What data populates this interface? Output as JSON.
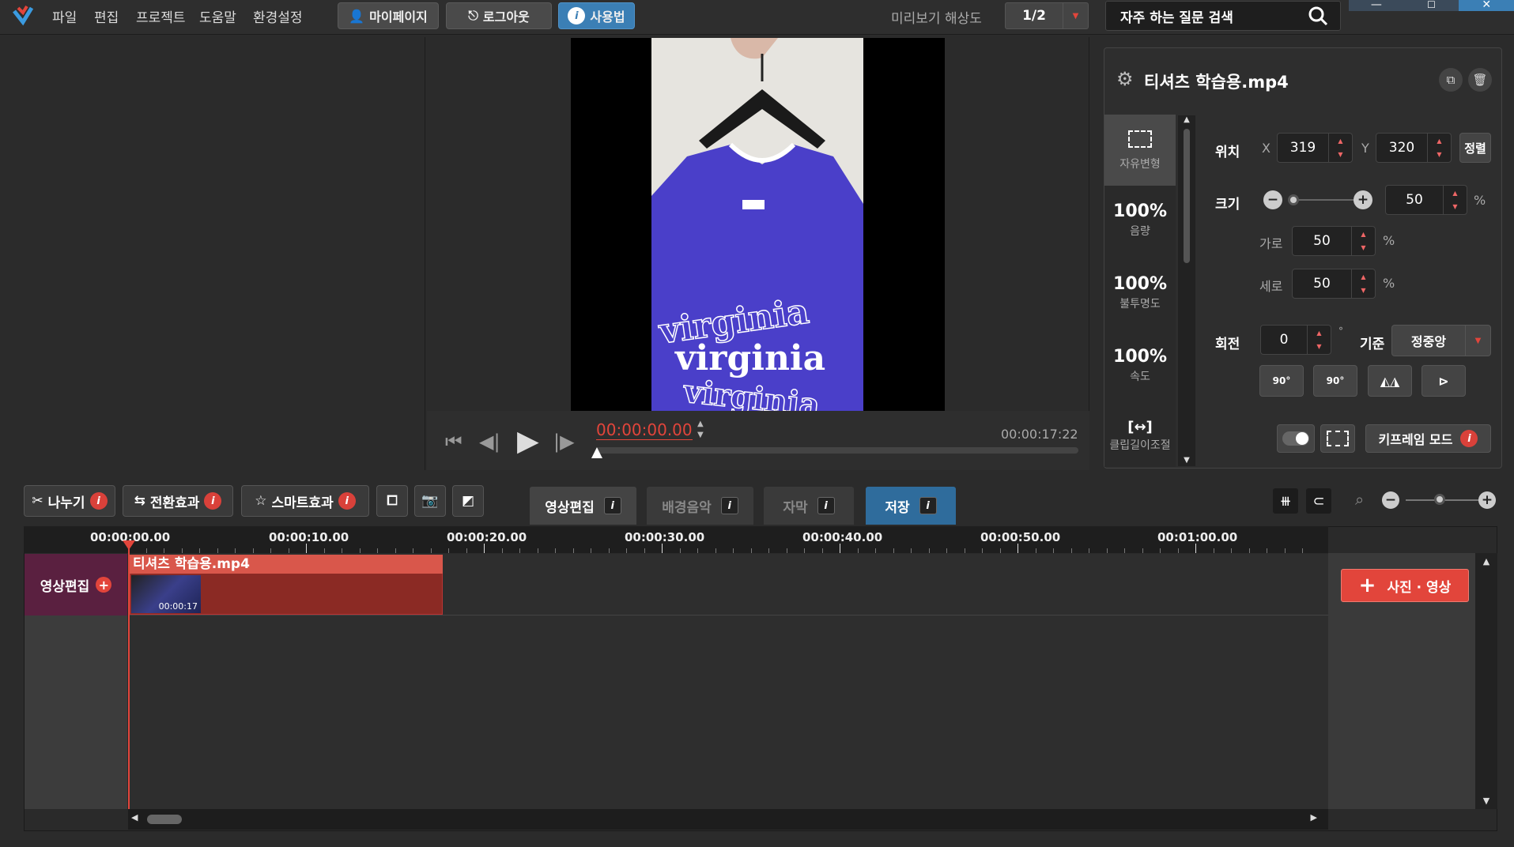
{
  "menu": {
    "file": "파일",
    "edit": "편집",
    "project": "프로젝트",
    "help": "도움말",
    "settings": "환경설정"
  },
  "topbuttons": {
    "mypage": "마이페이지",
    "logout": "로그아웃",
    "usage": "사용법"
  },
  "preview_res": {
    "label": "미리보기 해상도",
    "value": "1/2"
  },
  "faq_search": {
    "placeholder": "자주 하는 질문 검색"
  },
  "player": {
    "current_time": "00:00:00.00",
    "total_time": "00:00:17:22"
  },
  "video_text": {
    "line1": "virginia",
    "line2": "virginia",
    "line3": "virginia"
  },
  "props": {
    "filename": "티셔츠 학습용.mp4",
    "side_tabs": [
      {
        "value": "",
        "label": "자유변형"
      },
      {
        "value": "100%",
        "label": "음량"
      },
      {
        "value": "100%",
        "label": "불투명도"
      },
      {
        "value": "100%",
        "label": "속도"
      },
      {
        "value": "[↔]",
        "label": "클립길이조절"
      }
    ],
    "position_label": "위치",
    "x_label": "X",
    "x_value": "319",
    "y_label": "Y",
    "y_value": "320",
    "align_button": "정렬",
    "size_label": "크기",
    "size_value": "50",
    "size_level": 0.0,
    "pct": "%",
    "width_label": "가로",
    "width_value": "50",
    "height_label": "세로",
    "height_value": "50",
    "rotate_label": "회전",
    "rotate_value": "0",
    "degree": "°",
    "origin_label": "기준",
    "origin_value": "정중앙",
    "rot_cw": "90°",
    "rot_ccw": "90°",
    "keyframe_button": "키프레임 모드"
  },
  "tools": {
    "split": "나누기",
    "transition": "전환효과",
    "smart": "스마트효과"
  },
  "mode_tabs": {
    "video_edit": "영상편집",
    "bgm": "배경음악",
    "subtitle": "자막",
    "save": "저장"
  },
  "timeline": {
    "ticks": [
      "00:00:00.00",
      "00:00:10.00",
      "00:00:20.00",
      "00:00:30.00",
      "00:00:40.00",
      "00:00:50.00",
      "00:01:00.00"
    ],
    "track_label": "영상편집",
    "clip_name": "티셔츠 학습용.mp4",
    "clip_duration": "00:00:17",
    "add_media": "사진 · 영상"
  },
  "colors": {
    "accent_red": "#d9413a",
    "accent_blue": "#3b7fb5",
    "track_purple": "#5a2040",
    "clip_red": "#8b2a24"
  }
}
